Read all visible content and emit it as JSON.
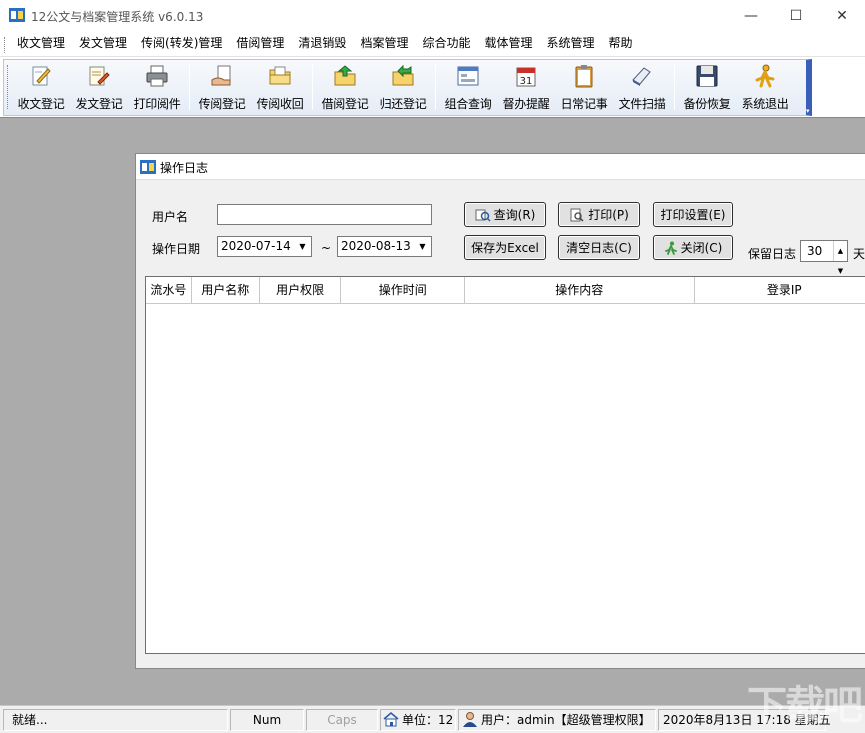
{
  "window": {
    "title": "12公文与档案管理系统 v6.0.13",
    "controls": {
      "minimize": "—",
      "maximize": "☐",
      "close": "✕"
    }
  },
  "menubar": {
    "items": [
      {
        "label": "收文管理"
      },
      {
        "label": "发文管理"
      },
      {
        "label": "传阅(转发)管理"
      },
      {
        "label": "借阅管理"
      },
      {
        "label": "清退销毁"
      },
      {
        "label": "档案管理"
      },
      {
        "label": "综合功能"
      },
      {
        "label": "载体管理"
      },
      {
        "label": "系统管理"
      },
      {
        "label": "帮助"
      }
    ]
  },
  "toolbar": {
    "buttons": [
      {
        "label": "收文登记",
        "icon": "pencil-document-icon"
      },
      {
        "label": "发文登记",
        "icon": "edit-document-icon"
      },
      {
        "label": "打印阅件",
        "icon": "printer-icon"
      },
      {
        "label": "传阅登记",
        "icon": "hand-document-icon"
      },
      {
        "label": "传阅收回",
        "icon": "folder-open-icon"
      },
      {
        "label": "借阅登记",
        "icon": "folder-up-arrow-icon"
      },
      {
        "label": "归还登记",
        "icon": "folder-return-arrow-icon"
      },
      {
        "label": "组合查询",
        "icon": "window-query-icon"
      },
      {
        "label": "督办提醒",
        "icon": "calendar-icon"
      },
      {
        "label": "日常记事",
        "icon": "clipboard-icon"
      },
      {
        "label": "文件扫描",
        "icon": "scanner-icon"
      },
      {
        "label": "备份恢复",
        "icon": "floppy-disk-icon"
      },
      {
        "label": "系统退出",
        "icon": "running-man-icon"
      }
    ]
  },
  "dialog": {
    "title": "操作日志",
    "username_label": "用户名",
    "username_value": "",
    "date_label": "操作日期",
    "date_from": "2020-07-14",
    "date_sep": "~",
    "date_to": "2020-08-13",
    "buttons": {
      "query": "查询(R)",
      "print": "打印(P)",
      "print_setup": "打印设置(E)",
      "save_excel": "保存为Excel",
      "clear_log": "清空日志(C)",
      "close": "关闭(C)"
    },
    "keep_label": "保留日志",
    "keep_value": "30",
    "keep_unit": "天",
    "table": {
      "columns": [
        "流水号",
        "用户名称",
        "用户权限",
        "操作时间",
        "操作内容",
        "登录IP"
      ],
      "rows": []
    }
  },
  "statusbar": {
    "status": "就绪...",
    "num": "Num",
    "caps": "Caps",
    "unit": "单位：12",
    "user": "用户：admin【超级管理权限】",
    "datetime": "2020年8月13日  17:18 星期五"
  },
  "watermark": "下载吧",
  "colors": {
    "mdi_background": "#ababab",
    "toolbar_accent": "#3a5fb8",
    "dialog_background": "#f0f0f0"
  }
}
